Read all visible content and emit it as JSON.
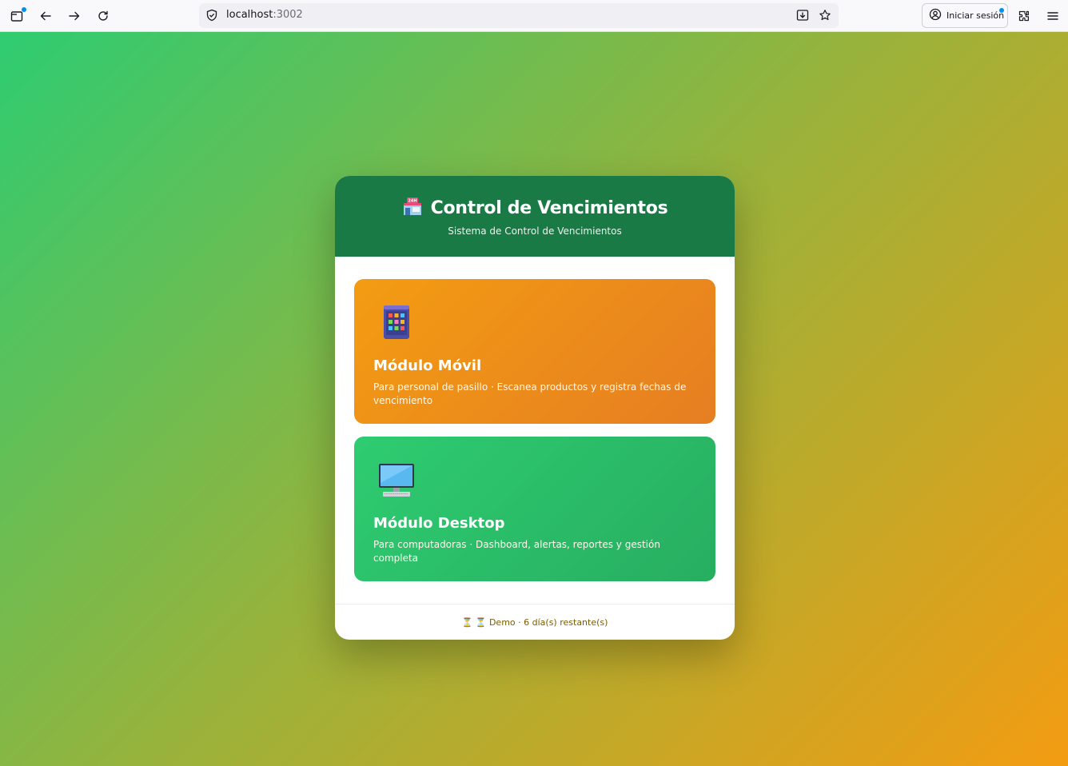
{
  "browser": {
    "url_host": "localhost",
    "url_port": ":3002",
    "signin_label": "Iniciar sesión",
    "icons": [
      "tab-icon",
      "back-icon",
      "forward-icon",
      "reload-icon",
      "shield-icon",
      "download-icon",
      "bookmark-star-icon",
      "account-icon",
      "extensions-icon",
      "menu-icon"
    ]
  },
  "header": {
    "icon": "store-icon",
    "title": "Control de Vencimientos",
    "subtitle": "Sistema de Control de Vencimientos"
  },
  "modules": [
    {
      "icon": "mobile-phone-icon",
      "title": "Módulo Móvil",
      "description": "Para personal de pasillo · Escanea productos y registra fechas de vencimiento"
    },
    {
      "icon": "desktop-computer-icon",
      "title": "Módulo Desktop",
      "description": "Para computadoras · Dashboard, alertas, reportes y gestión completa"
    }
  ],
  "footer": {
    "status": "⏳ ⏳ Demo · 6 día(s) restante(s)"
  },
  "colors": {
    "header_bg": "#1a7a45",
    "mobile_gradient": [
      "#f39c12",
      "#e67e22"
    ],
    "desktop_gradient": [
      "#2ecc71",
      "#27ae60"
    ],
    "page_gradient": [
      "#2ecc71",
      "#f39c12"
    ]
  }
}
